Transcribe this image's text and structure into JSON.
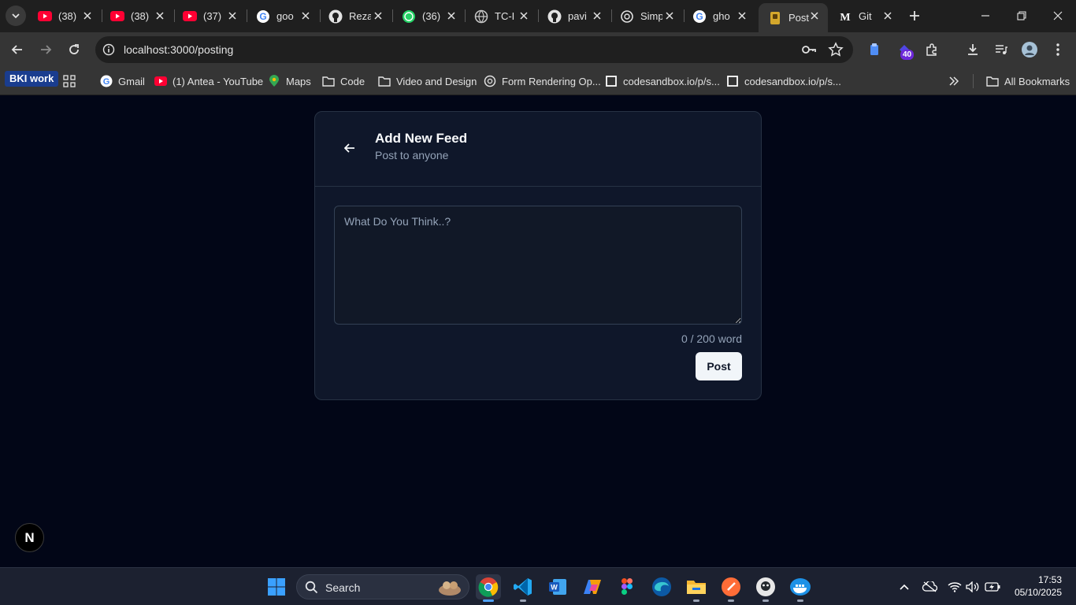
{
  "browser": {
    "tabs": [
      {
        "title": "(38)",
        "icon": "youtube-icon"
      },
      {
        "title": "(38)",
        "icon": "youtube-icon"
      },
      {
        "title": "(37)",
        "icon": "youtube-icon"
      },
      {
        "title": "goo",
        "icon": "google-icon"
      },
      {
        "title": "Reza",
        "icon": "github-icon"
      },
      {
        "title": "(36)",
        "icon": "whatsapp-icon"
      },
      {
        "title": "TC-I",
        "icon": "globe-icon"
      },
      {
        "title": "pavi",
        "icon": "github-icon"
      },
      {
        "title": "Simp",
        "icon": "chatgpt-icon"
      },
      {
        "title": "gho",
        "icon": "google-icon"
      },
      {
        "title": "Post",
        "icon": "app-icon",
        "active": true
      },
      {
        "title": "Git",
        "icon": "medium-icon"
      }
    ],
    "url": "localhost:3000/posting",
    "extension_badge": "40"
  },
  "bookmarks": {
    "workspace": "BKI work",
    "items": [
      {
        "label": "Gmail",
        "icon": "google-icon"
      },
      {
        "label": "(1) Antea - YouTube",
        "icon": "youtube-icon"
      },
      {
        "label": "Maps",
        "icon": "maps-icon"
      },
      {
        "label": "Code",
        "icon": "folder-icon"
      },
      {
        "label": "Video and Design",
        "icon": "folder-icon"
      },
      {
        "label": "Form Rendering Op...",
        "icon": "chatgpt-icon"
      },
      {
        "label": "codesandbox.io/p/s...",
        "icon": "codesandbox-icon"
      },
      {
        "label": "codesandbox.io/p/s...",
        "icon": "codesandbox-icon"
      }
    ],
    "all_bookmarks": "All Bookmarks"
  },
  "page": {
    "title": "Add New Feed",
    "subtitle": "Post to anyone",
    "textarea_placeholder": "What Do You Think..?",
    "counter": "0 / 200 word",
    "post_label": "Post",
    "next_badge": "N"
  },
  "taskbar": {
    "search_label": "Search",
    "time": "17:53",
    "date": "05/10/2025"
  },
  "colors": {
    "page_bg": "#020617",
    "card_bg": "#0f172a",
    "card_border": "#273244",
    "button_bg": "#f1f5f9",
    "muted_text": "#94a3b8"
  }
}
